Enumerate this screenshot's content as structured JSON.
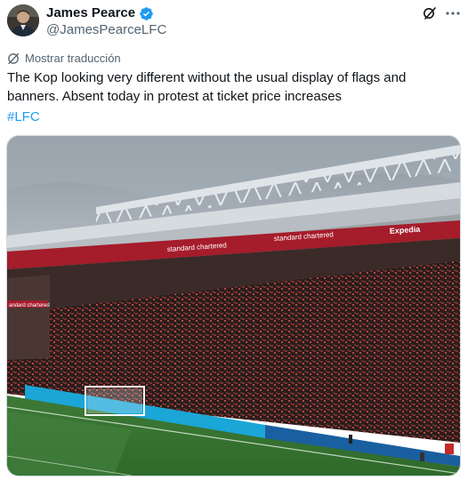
{
  "author": {
    "display_name": "James Pearce",
    "handle": "@JamesPearceLFC",
    "verified_icon": "verified-badge-icon",
    "avatar_icon": "avatar-icon"
  },
  "header": {
    "grok_icon": "grok-icon",
    "more_icon": "more-options-icon"
  },
  "translate": {
    "icon": "translate-icon",
    "label": "Mostrar traducción"
  },
  "tweet": {
    "text": "The Kop looking very different without the usual display of flags and banners. Absent today in protest at ticket price increases",
    "hashtag": "#LFC"
  },
  "media": {
    "stadium_signage": [
      "standard chartered",
      "Expedia",
      "standard chartered",
      "andard chartered"
    ]
  },
  "colors": {
    "link": "#1d9bf0",
    "secondary_text": "#536471",
    "primary_text": "#0f1419",
    "verified": "#1d9bf0"
  }
}
